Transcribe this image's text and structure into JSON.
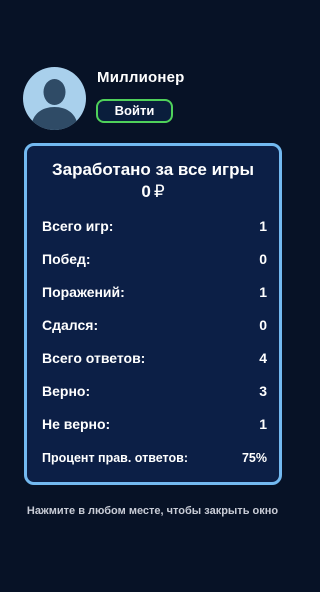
{
  "profile": {
    "name": "Миллионер",
    "login_label": "Войти"
  },
  "stats": {
    "title": "Заработано за все игры",
    "earned_amount": "0",
    "currency_symbol": "₽",
    "rows": [
      {
        "label": "Всего игр:",
        "value": "1"
      },
      {
        "label": "Побед:",
        "value": "0"
      },
      {
        "label": "Поражений:",
        "value": "1"
      },
      {
        "label": "Сдался:",
        "value": "0"
      },
      {
        "label": "Всего ответов:",
        "value": "4"
      },
      {
        "label": "Верно:",
        "value": "3"
      },
      {
        "label": "Не верно:",
        "value": "1"
      },
      {
        "label": "Процент прав. ответов:",
        "value": "75%"
      }
    ]
  },
  "footer": {
    "close_hint": "Нажмите в любом месте, чтобы закрыть окно"
  },
  "colors": {
    "background": "#071226",
    "card_background": "#0c1f46",
    "card_border": "#73b9f0",
    "login_border": "#4fd15a",
    "avatar_background": "#a9d0ec",
    "avatar_silhouette": "#2f4b66"
  }
}
